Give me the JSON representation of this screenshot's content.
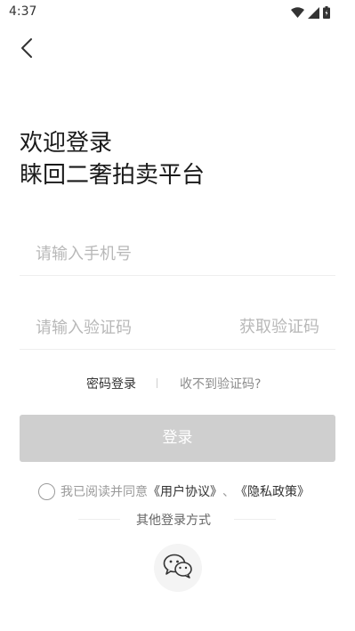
{
  "status_bar": {
    "time": "4:37",
    "icons": [
      "wifi-icon",
      "signal-icon",
      "battery-icon"
    ]
  },
  "header": {
    "back_icon": "chevron-left-icon"
  },
  "welcome": {
    "line1": "欢迎登录",
    "line2": "睐回二奢拍卖平台"
  },
  "form": {
    "phone_placeholder": "请输入手机号",
    "phone_value": "",
    "code_placeholder": "请输入验证码",
    "code_value": "",
    "get_code_label": "获取验证码"
  },
  "options": {
    "password_login": "密码登录",
    "no_code": "收不到验证码?"
  },
  "login_button": {
    "label": "登录",
    "enabled": false
  },
  "agreement": {
    "prefix": "我已阅读并同意",
    "user_agreement": "《用户协议》",
    "separator": "、",
    "privacy_policy": "《隐私政策》",
    "checked": false
  },
  "other_login": {
    "label": "其他登录方式",
    "methods": [
      "wechat-icon"
    ]
  },
  "colors": {
    "button_disabled": "#cfcfcf",
    "placeholder": "#b8b8b8",
    "text_dark": "#1a1a1a"
  }
}
